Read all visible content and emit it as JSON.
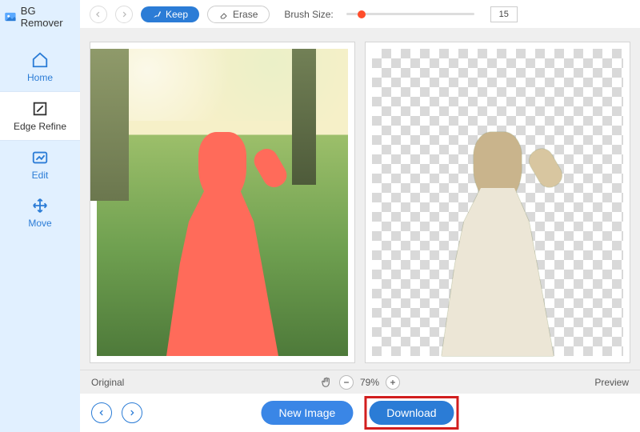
{
  "app": {
    "title": "BG Remover"
  },
  "sidebar": {
    "items": [
      {
        "label": "Home",
        "icon": "home-icon"
      },
      {
        "label": "Edge Refine",
        "icon": "edge-refine-icon"
      },
      {
        "label": "Edit",
        "icon": "edit-icon"
      },
      {
        "label": "Move",
        "icon": "move-icon"
      }
    ]
  },
  "toolbar": {
    "keep_label": "Keep",
    "erase_label": "Erase",
    "brush_label": "Brush Size:",
    "brush_value": "15"
  },
  "status": {
    "original_label": "Original",
    "preview_label": "Preview",
    "zoom": "79%"
  },
  "footer": {
    "new_image_label": "New Image",
    "download_label": "Download"
  },
  "colors": {
    "accent": "#2b7cd6",
    "mask": "#ff6b5a",
    "highlight_box": "#d21e1e",
    "slider_thumb": "#ff4d2b",
    "sidebar_bg": "#e1f0ff"
  }
}
